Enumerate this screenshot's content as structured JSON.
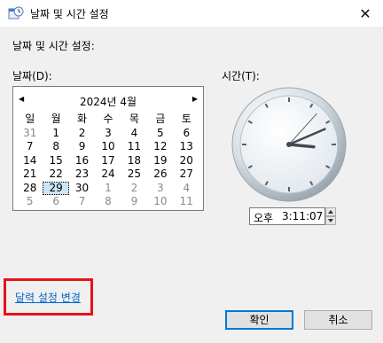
{
  "window": {
    "title": "날짜 및 시간 설정",
    "close_glyph": "✕"
  },
  "labels": {
    "section": "날짜 및 시간 설정:",
    "date": "날짜(D):",
    "time": "시간(T):"
  },
  "calendar": {
    "month_title": "2024년 4월",
    "prev_glyph": "◀",
    "next_glyph": "▶",
    "weekdays": [
      "일",
      "월",
      "화",
      "수",
      "목",
      "금",
      "토"
    ],
    "weeks": [
      [
        "31",
        "1",
        "2",
        "3",
        "4",
        "5",
        "6"
      ],
      [
        "7",
        "8",
        "9",
        "10",
        "11",
        "12",
        "13"
      ],
      [
        "14",
        "15",
        "16",
        "17",
        "18",
        "19",
        "20"
      ],
      [
        "21",
        "22",
        "23",
        "24",
        "25",
        "26",
        "27"
      ],
      [
        "28",
        "29",
        "30",
        "1",
        "2",
        "3",
        "4"
      ],
      [
        "5",
        "6",
        "7",
        "8",
        "9",
        "10",
        "11"
      ]
    ],
    "selected_day": "29"
  },
  "clock": {
    "hour": 3,
    "minute": 11,
    "second": 7
  },
  "time_field": {
    "ampm": "오후",
    "value": "3:11:07"
  },
  "link": {
    "label": "달력 설정 변경"
  },
  "buttons": {
    "ok": "확인",
    "cancel": "취소"
  },
  "colors": {
    "accent": "#0078d7",
    "highlight_box": "#e8121b",
    "link": "#0066cc"
  }
}
